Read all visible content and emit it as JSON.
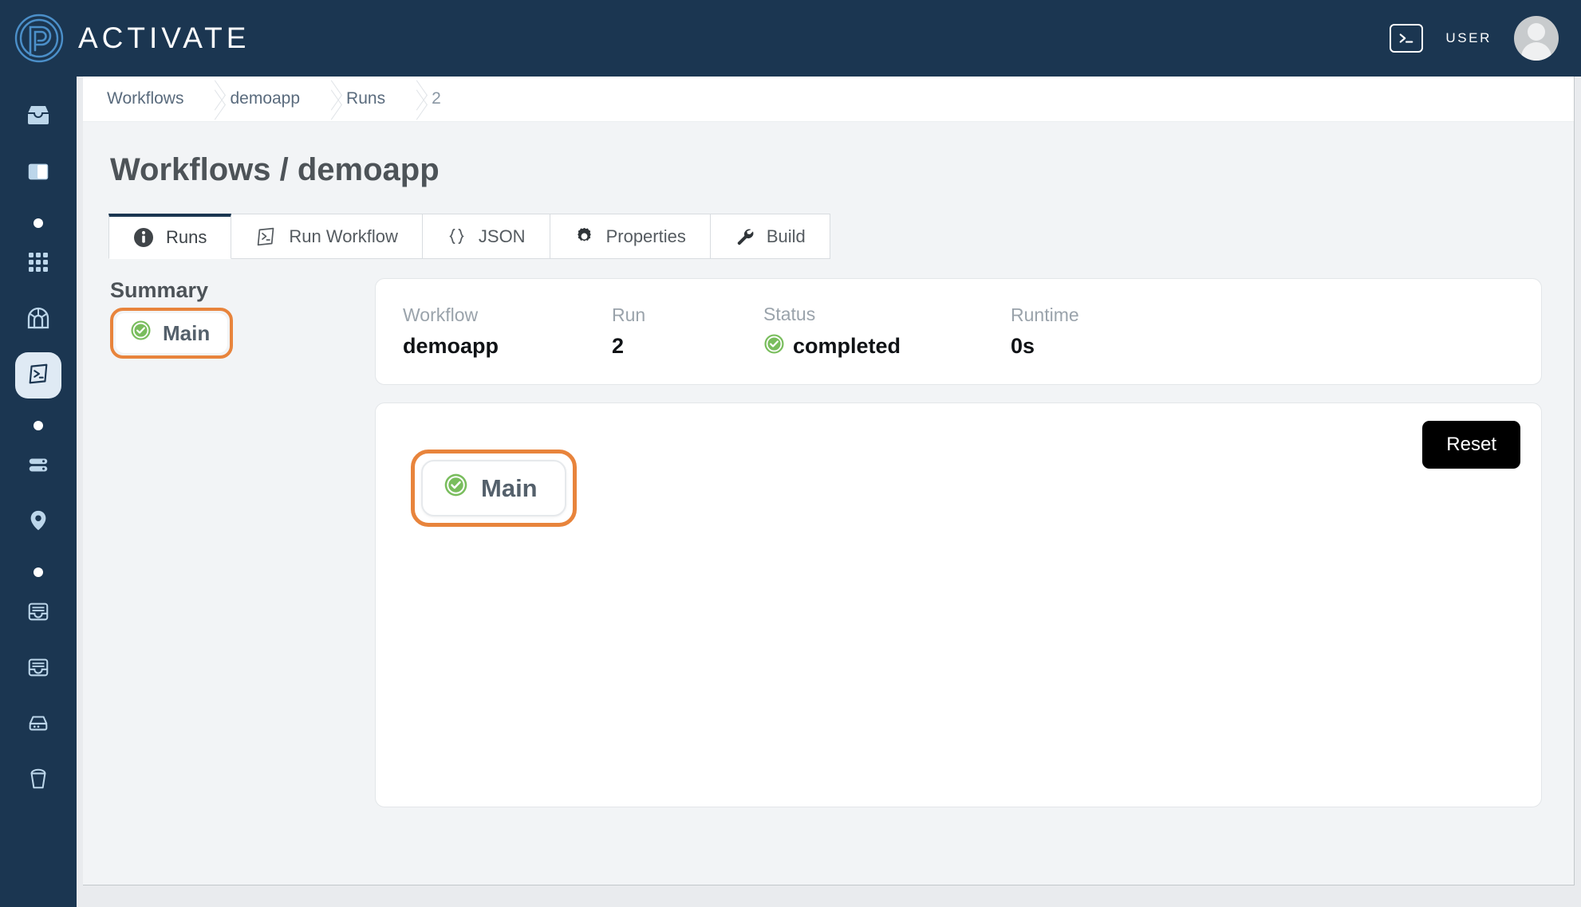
{
  "topbar": {
    "logo_icon": "activate-spiral-logo",
    "brand": "ACTIVATE",
    "terminal_icon": "terminal-icon",
    "user_label": "USER",
    "avatar_icon": "user-avatar"
  },
  "sidebar": {
    "items": [
      {
        "icon": "inbox-icon",
        "type": "icon",
        "active": false
      },
      {
        "icon": "sidebar-panel-icon",
        "type": "icon",
        "active": false
      },
      {
        "icon": "dot-separator",
        "type": "dot",
        "active": false
      },
      {
        "icon": "grid-apps-icon",
        "type": "icon",
        "active": false
      },
      {
        "icon": "tunnel-icon",
        "type": "icon",
        "active": false
      },
      {
        "icon": "terminal-icon",
        "type": "icon",
        "active": true
      },
      {
        "icon": "dot-separator",
        "type": "dot",
        "active": false
      },
      {
        "icon": "server-icon",
        "type": "icon",
        "active": false
      },
      {
        "icon": "location-pin-icon",
        "type": "icon",
        "active": false
      },
      {
        "icon": "dot-separator",
        "type": "dot",
        "active": false
      },
      {
        "icon": "archive-box-icon",
        "type": "icon",
        "active": false
      },
      {
        "icon": "archive-box-icon",
        "type": "icon",
        "active": false
      },
      {
        "icon": "drive-icon",
        "type": "icon",
        "active": false
      },
      {
        "icon": "bucket-icon",
        "type": "icon",
        "active": false
      }
    ]
  },
  "breadcrumb": {
    "items": [
      "Workflows",
      "demoapp",
      "Runs",
      "2"
    ]
  },
  "page": {
    "title": "Workflows / demoapp"
  },
  "tabs": [
    {
      "label": "Runs",
      "icon": "info-circle-icon",
      "active": true
    },
    {
      "label": "Run Workflow",
      "icon": "terminal-icon",
      "active": false
    },
    {
      "label": "JSON",
      "icon": "braces-icon",
      "active": false
    },
    {
      "label": "Properties",
      "icon": "gear-icon",
      "active": false
    },
    {
      "label": "Build",
      "icon": "wrench-icon",
      "active": false
    }
  ],
  "summary": {
    "title": "Summary",
    "node_label": "Main",
    "node_status_icon": "check-circle-icon",
    "highlight_color": "#e8843c"
  },
  "run_info": {
    "workflow_label": "Workflow",
    "workflow_value": "demoapp",
    "run_label": "Run",
    "run_value": "2",
    "status_label": "Status",
    "status_value": "completed",
    "status_icon": "check-circle-icon",
    "status_color": "#79bd5d",
    "runtime_label": "Runtime",
    "runtime_value": "0s"
  },
  "graph": {
    "reset_label": "Reset",
    "node_label": "Main",
    "node_status_icon": "check-circle-icon",
    "highlight_color": "#e8843c"
  }
}
